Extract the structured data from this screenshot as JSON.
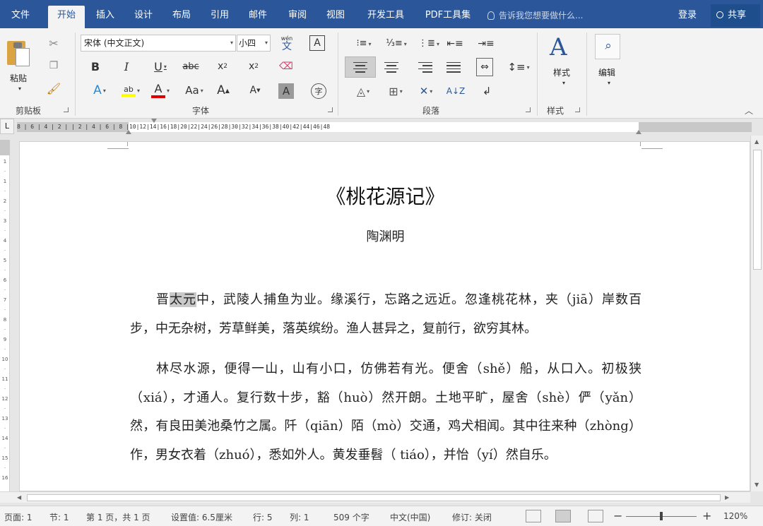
{
  "tabs": [
    "文件",
    "开始",
    "插入",
    "设计",
    "布局",
    "引用",
    "邮件",
    "审阅",
    "视图",
    "开发工具",
    "PDF工具集"
  ],
  "active_tab": "开始",
  "tell_me": "告诉我您想要做什么...",
  "login": "登录",
  "share": "共享",
  "clipboard": {
    "paste": "粘贴",
    "group": "剪贴板"
  },
  "font": {
    "name": "宋体 (中文正文)",
    "size": "小四",
    "group": "字体",
    "pinyin_top": "wén",
    "pinyin_char": "文",
    "border_char": "A",
    "aa_label": "Aa",
    "grow": "A",
    "shrink": "A",
    "shade_char": "A",
    "encircle_char": "字",
    "highlight_text": "ab",
    "font_color_char": "A",
    "text_effect_char": "A",
    "highlight_color": "#ffff00",
    "font_color": "#e00000"
  },
  "paragraph": {
    "group": "段落"
  },
  "styles": {
    "label": "样式",
    "group": "样式"
  },
  "editing": {
    "label": "编辑"
  },
  "ruler": {
    "corner": "L",
    "numbers": "8 | 6 | 4 | 2 |   | 2 | 4 | 6 | 8 |10|12|14|16|18|20|22|24|26|28|30|32|34|36|38|40|42|44|46|48",
    "vertical": [
      "1",
      "",
      "1",
      "",
      "2",
      "",
      "3",
      "",
      "4",
      "",
      "5",
      "",
      "6",
      "",
      "7",
      "",
      "8",
      "",
      "9",
      "",
      "10",
      "",
      "11",
      "",
      "12",
      "",
      "13",
      "",
      "14",
      "",
      "15",
      "",
      "16"
    ]
  },
  "document": {
    "title": "《桃花源记》",
    "author": "陶渊明",
    "p1_pre": "晋",
    "p1_hl": "太元",
    "p1_post": "中，武陵人捕鱼为业。缘溪行，忘路之远近。忽逢桃花林，夹（jiā）岸数百步，中无杂树，芳草鲜美，落英缤纷。渔人甚异之，复前行，欲穷其林。",
    "p2": "林尽水源，便得一山，山有小口，仿佛若有光。便舍（shě）船，从口入。初极狭（xiá），才通人。复行数十步，豁（huò）然开朗。土地平旷，屋舍（shè）俨（yǎn）然，有良田美池桑竹之属。阡（qiān）陌（mò）交通，鸡犬相闻。其中往来种（zhòng）作，男女衣着（zhuó），悉如外人。黄发垂髫（ tiáo），并怡（yí）然自乐。"
  },
  "status": {
    "page": "页面: 1",
    "section": "节: 1",
    "page_of": "第 1 页，共 1 页",
    "setting": "设置值: 6.5厘米",
    "line": "行: 5",
    "column": "列: 1",
    "words": "509 个字",
    "language": "中文(中国)",
    "track": "修订: 关闭",
    "zoom": "120%"
  }
}
